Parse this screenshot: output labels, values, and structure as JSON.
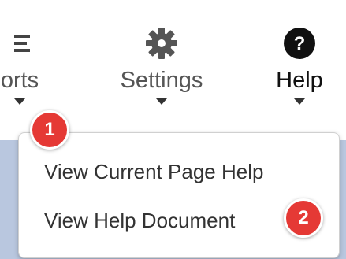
{
  "nav": {
    "reports": {
      "label": "orts",
      "icon": "list-icon"
    },
    "settings": {
      "label": "Settings",
      "icon": "gear-icon"
    },
    "help": {
      "label": "Help",
      "icon": "question-circle-icon"
    }
  },
  "dropdown": {
    "items": [
      {
        "label": "View Current Page Help"
      },
      {
        "label": "View Help Document"
      }
    ]
  },
  "badges": [
    "1",
    "2"
  ],
  "colors": {
    "badge": "#e53935",
    "band": "#b9c7df"
  }
}
